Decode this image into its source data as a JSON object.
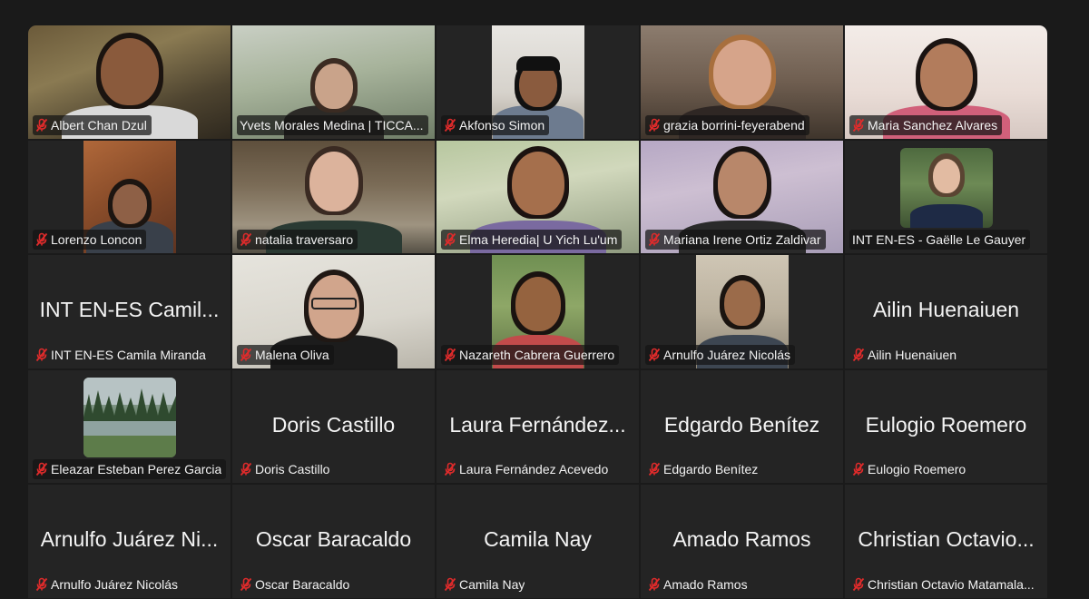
{
  "participants": [
    {
      "name": "Albert Chan Dzul",
      "muted": true,
      "video": true,
      "scene": "wall-green"
    },
    {
      "name": "Yvets Morales Medina | TICCA...",
      "muted": false,
      "video": true,
      "scene": "window-pale"
    },
    {
      "name": "Akfonso Simon",
      "muted": true,
      "video": true,
      "scene": "wall-white"
    },
    {
      "name": "grazia borrini-feyerabend",
      "muted": true,
      "video": true,
      "scene": "shelf"
    },
    {
      "name": "Maria Sanchez Alvares",
      "muted": true,
      "video": true,
      "scene": "butterfly"
    },
    {
      "name": "Lorenzo Loncon",
      "muted": true,
      "video": true,
      "scene": "wood-roof"
    },
    {
      "name": "natalia traversaro",
      "muted": true,
      "video": true,
      "scene": "kitchen"
    },
    {
      "name": "Elma Heredia| U Yich Lu'um",
      "muted": true,
      "video": true,
      "scene": "green-room"
    },
    {
      "name": "Mariana Irene Ortiz Zaldivar",
      "muted": true,
      "video": true,
      "scene": "lilac-map"
    },
    {
      "name": "INT EN-ES - Gaëlle Le Gauyer",
      "muted": false,
      "video": true,
      "scene": "forest"
    },
    {
      "name": "INT EN-ES Camila Miranda",
      "display_name": "INT EN-ES Camil...",
      "muted": true,
      "video": false
    },
    {
      "name": "Malena Oliva",
      "muted": true,
      "video": true,
      "scene": "whiteboard"
    },
    {
      "name": "Nazareth Cabrera Guerrero",
      "muted": true,
      "video": true,
      "scene": "garden"
    },
    {
      "name": "Arnulfo Juárez Nicolás",
      "muted": true,
      "video": true,
      "scene": "office-wall"
    },
    {
      "name": "Ailin Huenaiuen",
      "display_name": "Ailin Huenaiuen",
      "muted": true,
      "video": false
    },
    {
      "name": "Eleazar Esteban Perez Garcia",
      "muted": true,
      "video": true,
      "scene": "lake"
    },
    {
      "name": "Doris Castillo",
      "display_name": "Doris Castillo",
      "muted": true,
      "video": false
    },
    {
      "name": "Laura Fernández Acevedo",
      "display_name": "Laura Fernández...",
      "muted": true,
      "video": false
    },
    {
      "name": "Edgardo Benítez",
      "display_name": "Edgardo Benítez",
      "muted": true,
      "video": false
    },
    {
      "name": "Eulogio Roemero",
      "display_name": "Eulogio Roemero",
      "muted": true,
      "video": false
    },
    {
      "name": "Arnulfo Juárez Nicolás",
      "display_name": "Arnulfo Juárez Ni...",
      "muted": true,
      "video": false
    },
    {
      "name": "Oscar Baracaldo",
      "display_name": "Oscar Baracaldo",
      "muted": true,
      "video": false
    },
    {
      "name": "Camila Nay",
      "display_name": "Camila Nay",
      "muted": true,
      "video": false
    },
    {
      "name": "Amado Ramos",
      "display_name": "Amado Ramos",
      "muted": true,
      "video": false
    },
    {
      "name": "Christian Octavio Matamala...",
      "display_name": "Christian Octavio...",
      "muted": true,
      "video": false
    }
  ],
  "icons": {
    "muted_mic": "mic-off-icon"
  },
  "colors": {
    "background": "#1a1a1a",
    "tile": "#242424",
    "mute_red": "#e02b2b",
    "label_text": "#f2f2f2"
  }
}
